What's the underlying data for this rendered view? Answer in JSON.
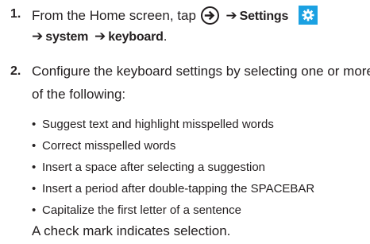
{
  "step1": {
    "number": "1.",
    "text_before": "From the Home screen, tap",
    "arrow1": "➔",
    "settings_label": "Settings",
    "arrow2": "➔",
    "system_label": "system",
    "arrow3": "➔",
    "keyboard_label": "keyboard",
    "period": ".",
    "icons": [
      "arrow-circle-icon",
      "gear-icon"
    ],
    "gear_color": "#1ba1e2"
  },
  "step2": {
    "number": "2.",
    "line1": "Configure the keyboard settings by selecting one or more",
    "line2": "of the following:"
  },
  "options": [
    "Suggest text and highlight misspelled words",
    "Correct misspelled words",
    "Insert a space after selecting a suggestion",
    "Insert a period after double-tapping the SPACEBAR",
    "Capitalize the first letter of a sentence"
  ],
  "note": "A check mark indicates selection."
}
